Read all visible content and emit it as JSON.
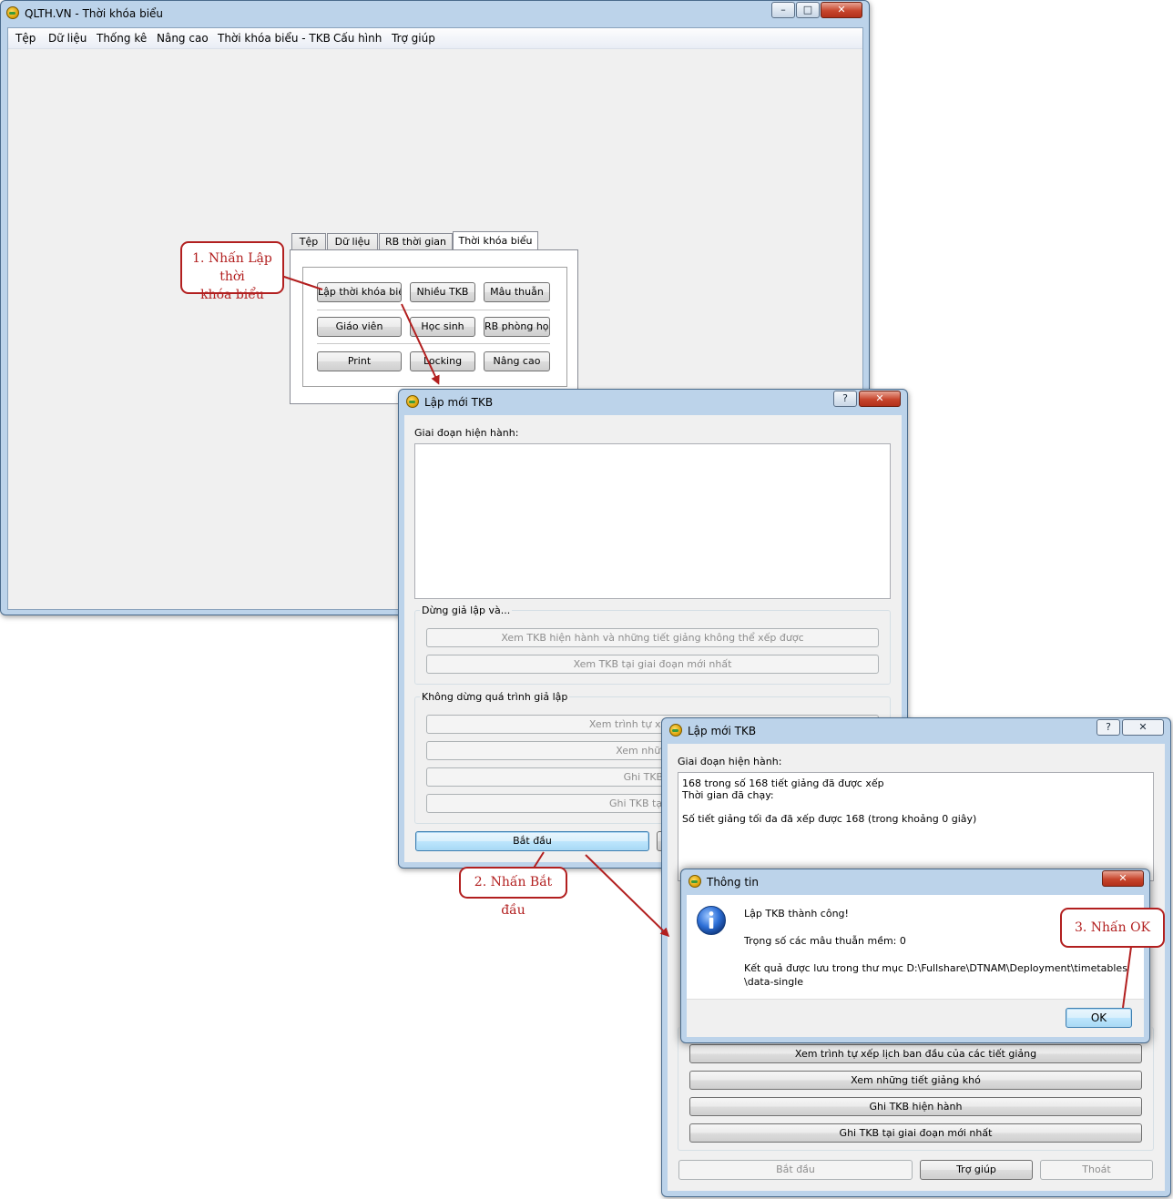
{
  "main_window": {
    "title": "QLTH.VN - Thời khóa biểu",
    "menu": [
      "Tệp",
      "Dữ liệu",
      "Thống kê",
      "Nâng cao",
      "Thời khóa biểu - TKB",
      "Cấu hình",
      "Trợ giúp"
    ],
    "tabs": [
      "Tệp",
      "Dữ liệu",
      "RB thời gian",
      "Thời khóa biểu"
    ],
    "buttons": [
      "Lập thời khóa biểu",
      "Nhiều TKB",
      "Mâu thuẫn",
      "Giáo viên",
      "Học sinh",
      "RB phòng học",
      "Print",
      "Locking",
      "Nâng cao"
    ]
  },
  "dialog1": {
    "title": "Lập mới TKB",
    "help": "?",
    "stage_label": "Giai đoạn hiện hành:",
    "group_stop_label": "Dừng giả lập và...",
    "stop_btn_1": "Xem TKB hiện hành và những tiết giảng không thể xếp được",
    "stop_btn_2": "Xem TKB tại giai đoạn mới nhất",
    "group_nostop_label": "Không dừng quá trình giả lập",
    "nostop_btn_1": "Xem trình tự xếp lịch ban",
    "nostop_btn_2": "Xem những tiế",
    "nostop_btn_3": "Ghi TKB hiệ",
    "nostop_btn_4": "Ghi TKB tại giai đ",
    "start": "Bắt đầu"
  },
  "dialog2": {
    "title": "Lập mới TKB",
    "help": "?",
    "stage_label": "Giai đoạn hiện hành:",
    "text_line_1": "168 trong số 168 tiết giảng đã được xếp",
    "text_line_2": "Thời gian đã chạy:",
    "text_line_3": "Số tiết giảng tối đa đã xếp được 168 (trong khoảng 0 giây)",
    "btn_1": "Xem trình tự xếp lịch ban đầu của các tiết giảng",
    "btn_2": "Xem những tiết giảng khó",
    "btn_3": "Ghi TKB hiện hành",
    "btn_4": "Ghi TKB tại giai đoạn mới nhất",
    "start": "Bắt đầu",
    "help_btn": "Trợ giúp",
    "exit_btn": "Thoát"
  },
  "info_dialog": {
    "title": "Thông tin",
    "line_1": "Lập TKB thành công!",
    "line_2": "Trọng số các mâu thuẫn mềm: 0",
    "line_3": "Kết quả được lưu trong thư mục D:\\Fullshare\\DTNAM\\Deployment\\timetables",
    "line_4": "\\data-single",
    "ok": "OK"
  },
  "callouts": {
    "step_1_line_1": "1. Nhấn Lập thời",
    "step_1_line_2": "khóa biểu",
    "step_2": "2. Nhấn Bắt đầu",
    "step_3": "3. Nhấn OK"
  },
  "colors": {
    "callout": "#b21f1f",
    "frame": "#bcd3ea",
    "client": "#f0f0f0"
  }
}
